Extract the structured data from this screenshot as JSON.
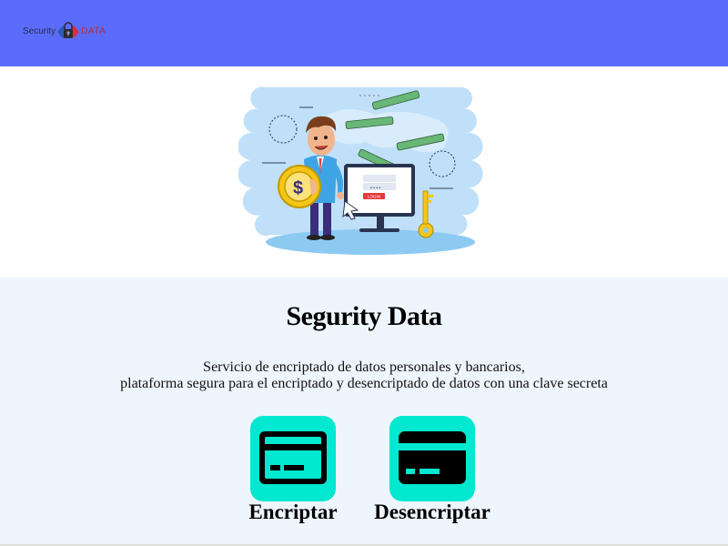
{
  "header": {
    "logo": {
      "text_left": "Security",
      "text_right": "DATA",
      "icon": "lock-icon"
    }
  },
  "hero": {
    "illustration": "security-payment-illustration",
    "login_button_text": "LOGIN"
  },
  "info": {
    "title": "Segurity Data",
    "description_line1": "Servicio de encriptado de datos personales y bancarios,",
    "description_line2": "plataforma segura para el encriptado y desencriptado de datos con una clave secreta"
  },
  "actions": [
    {
      "label": "Encriptar",
      "icon": "credit-card-outline-icon"
    },
    {
      "label": "Desencriptar",
      "icon": "credit-card-solid-icon"
    }
  ],
  "colors": {
    "navbar": "#5b6cfc",
    "tile": "#00e8d0",
    "info_background": "#eef5fd"
  }
}
